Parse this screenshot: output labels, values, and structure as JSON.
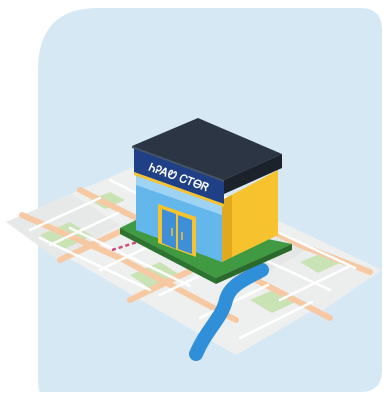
{
  "store": {
    "sign_text": "ᏂᎮᎪᏬ ᏟᎢᎾᏒ"
  },
  "colors": {
    "panel": "#d7e8f5",
    "map_base": "#eef0ef",
    "map_road_major": "#f6c9a3",
    "map_road_minor": "#ffffff",
    "map_park": "#c9e3b4",
    "map_water": "#2f8fd8",
    "route": "#d04a7e",
    "roof": "#2b3543",
    "sign_panel": "#1f3f86",
    "side_wall": "#f6c22e",
    "front_glass": "#64b7ea",
    "door_frame": "#f6c22e",
    "base_green": "#3f9a42"
  }
}
